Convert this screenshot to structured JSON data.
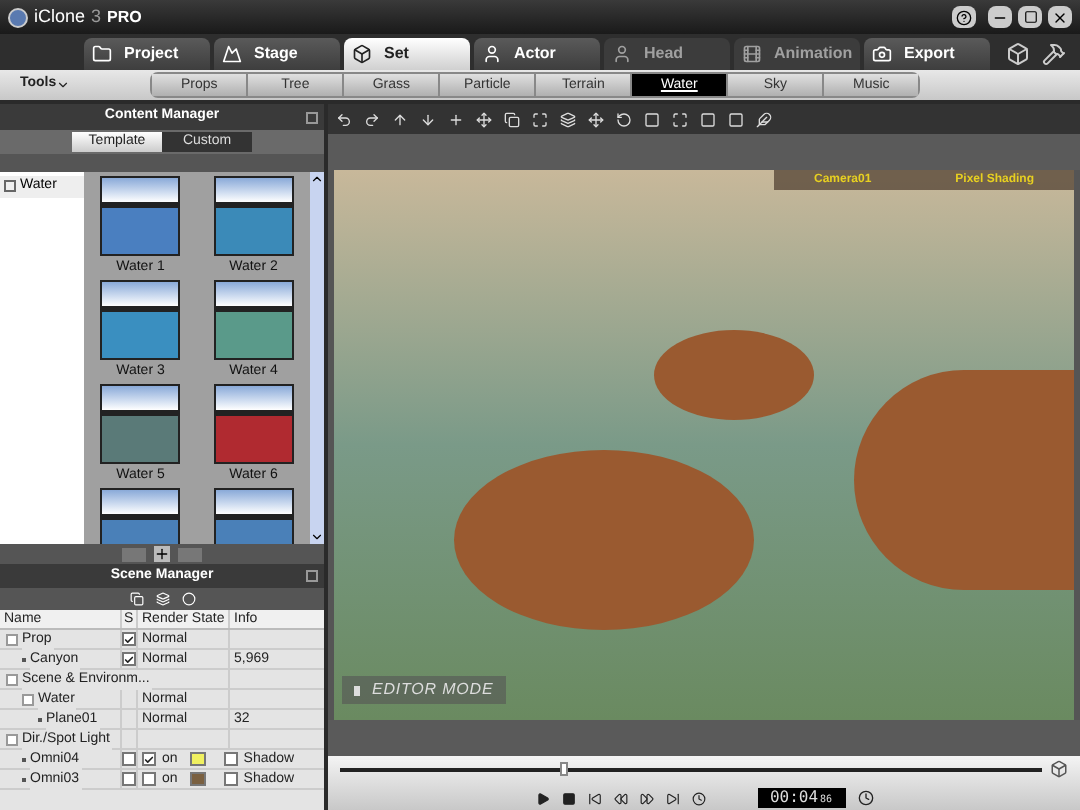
{
  "app": {
    "name": "iClone",
    "version": "3",
    "edition": "PRO"
  },
  "main_tabs": [
    {
      "label": "Project",
      "selected": false,
      "disabled": false
    },
    {
      "label": "Stage",
      "selected": false,
      "disabled": false
    },
    {
      "label": "Set",
      "selected": true,
      "disabled": false
    },
    {
      "label": "Actor",
      "selected": false,
      "disabled": false
    },
    {
      "label": "Head",
      "selected": false,
      "disabled": true
    },
    {
      "label": "Animation",
      "selected": false,
      "disabled": true
    },
    {
      "label": "Export",
      "selected": false,
      "disabled": false
    }
  ],
  "tools_menu": "Tools",
  "sub_tabs": [
    {
      "label": "Props",
      "selected": false
    },
    {
      "label": "Tree",
      "selected": false
    },
    {
      "label": "Grass",
      "selected": false
    },
    {
      "label": "Particle",
      "selected": false
    },
    {
      "label": "Terrain",
      "selected": false
    },
    {
      "label": "Water",
      "selected": true
    },
    {
      "label": "Sky",
      "selected": false
    },
    {
      "label": "Music",
      "selected": false
    }
  ],
  "content_manager": {
    "title": "Content Manager",
    "tabs": [
      {
        "label": "Template",
        "selected": true
      },
      {
        "label": "Custom",
        "selected": false
      }
    ],
    "tree": [
      {
        "label": "Water"
      }
    ],
    "items": [
      {
        "label": "Water 1",
        "color": "#4a7fc0"
      },
      {
        "label": "Water 2",
        "color": "#3b8ab8"
      },
      {
        "label": "Water 3",
        "color": "#3a8fc0"
      },
      {
        "label": "Water 4",
        "color": "#5a9a8a"
      },
      {
        "label": "Water 5",
        "color": "#5a7a78"
      },
      {
        "label": "Water 6",
        "color": "#b02a30"
      },
      {
        "color": "#4a80b8"
      },
      {
        "color": "#4a80b8"
      }
    ]
  },
  "scene_manager": {
    "title": "Scene Manager",
    "columns": [
      "Name",
      "S",
      "Render State",
      "Info"
    ],
    "rows": [
      {
        "name": "Prop",
        "visible": true,
        "render_state": "Normal",
        "children": [
          {
            "name": "Canyon",
            "visible": true,
            "render_state": "Normal",
            "info": "5,969"
          }
        ]
      },
      {
        "name": "Scene & Environm...",
        "children": [
          {
            "name": "Water",
            "render_state": "Normal",
            "children": [
              {
                "name": "Plane01",
                "render_state": "Normal",
                "info": "32"
              }
            ]
          }
        ]
      },
      {
        "name": "Dir./Spot Light",
        "children": [
          {
            "name": "Omni04",
            "kind": "light",
            "visible": false,
            "on": true,
            "on_label": "on",
            "color": "#f0f060",
            "shadow": false,
            "shadow_label": "Shadow"
          },
          {
            "name": "Omni03",
            "kind": "light",
            "visible": false,
            "on": false,
            "on_label": "on",
            "color": "#7a6040",
            "shadow": false,
            "shadow_label": "Shadow"
          }
        ]
      }
    ]
  },
  "viewport": {
    "camera": "Camera01",
    "shading": "Pixel Shading",
    "mode": "EDITOR MODE"
  },
  "timeline": {
    "level": 0.32,
    "time": "00:04",
    "frames": "86"
  }
}
